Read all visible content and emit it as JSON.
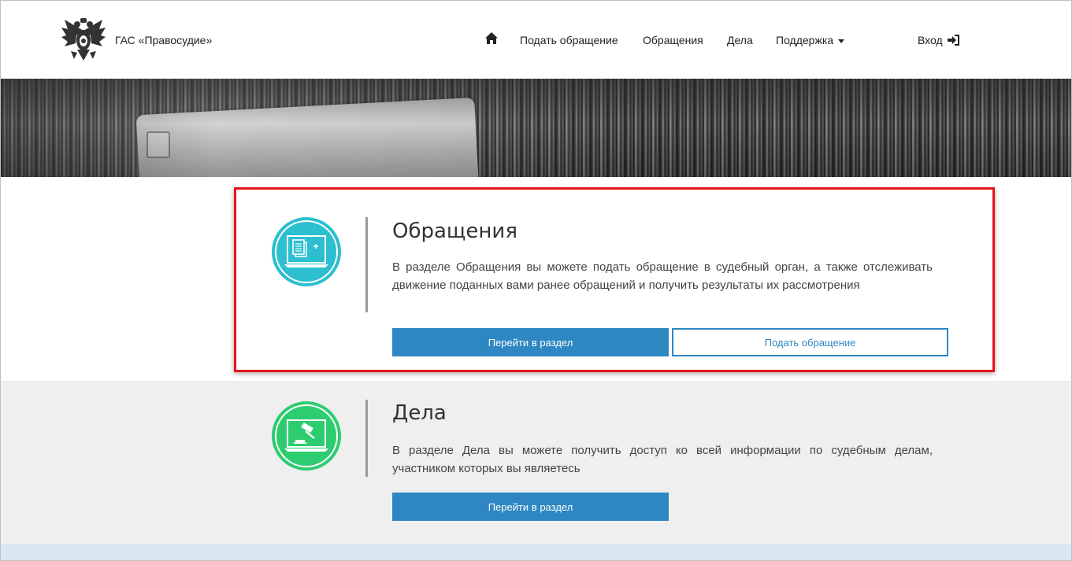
{
  "header": {
    "brand": "ГАС «Правосудие»",
    "nav": {
      "home_icon": "home-icon",
      "submit": "Подать обращение",
      "appeals": "Обращения",
      "cases": "Дела",
      "support": "Поддержка",
      "login": "Вход",
      "login_icon": "sign-in-icon"
    }
  },
  "sections": {
    "appeals": {
      "title": "Обращения",
      "description": "В разделе Обращения вы можете подать обращение в судебный орган, а также отслеживать движение поданных вами ранее обращений и получить результаты их рассмотрения",
      "go_button": "Перейти в раздел",
      "submit_button": "Подать обращение",
      "icon": "document-add-icon",
      "color": "#2cbfcf"
    },
    "cases": {
      "title": "Дела",
      "description": "В разделе Дела вы можете получить доступ ко всей информации по судебным делам, участником которых вы являетесь",
      "go_button": "Перейти в раздел",
      "icon": "gavel-icon",
      "color": "#2ecc71"
    }
  },
  "colors": {
    "primary": "#2e87c2",
    "highlight": "#e8121b"
  }
}
